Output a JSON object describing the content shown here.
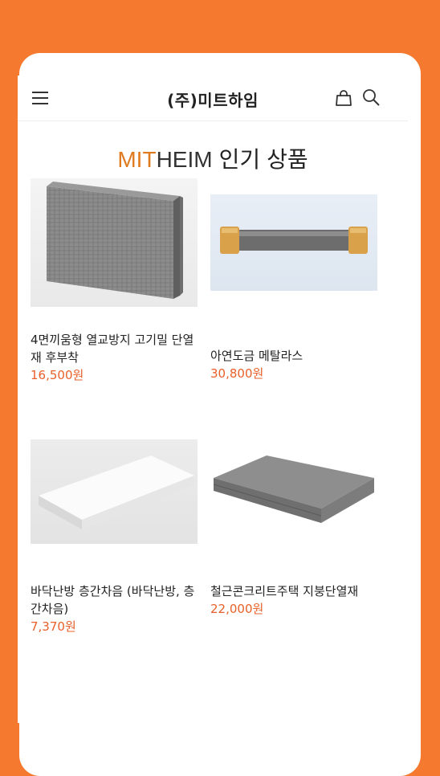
{
  "app": {
    "brand_title": "(주)미트하임",
    "section_title_prefix_1": "MIT",
    "section_title_prefix_2": "HEIM",
    "section_title_suffix": " 인기 상품"
  },
  "icons": {
    "menu": "hamburger-menu-icon",
    "bag": "shopping-bag-icon",
    "search": "search-icon"
  },
  "colors": {
    "background": "#F57A30",
    "brand_accent": "#E07A1F",
    "price": "#E8602A"
  },
  "products": [
    {
      "name": "4면끼움형 열교방지 고기밀 단열재 후부착",
      "price": "16,500원"
    },
    {
      "name": "아연도금 메탈라스",
      "price": "30,800원"
    },
    {
      "name": "바닥난방 층간차음 (바닥난방, 층간차음)",
      "price": "7,370원"
    },
    {
      "name": "철근콘크리트주택 지붕단열재",
      "price": "22,000원"
    }
  ]
}
